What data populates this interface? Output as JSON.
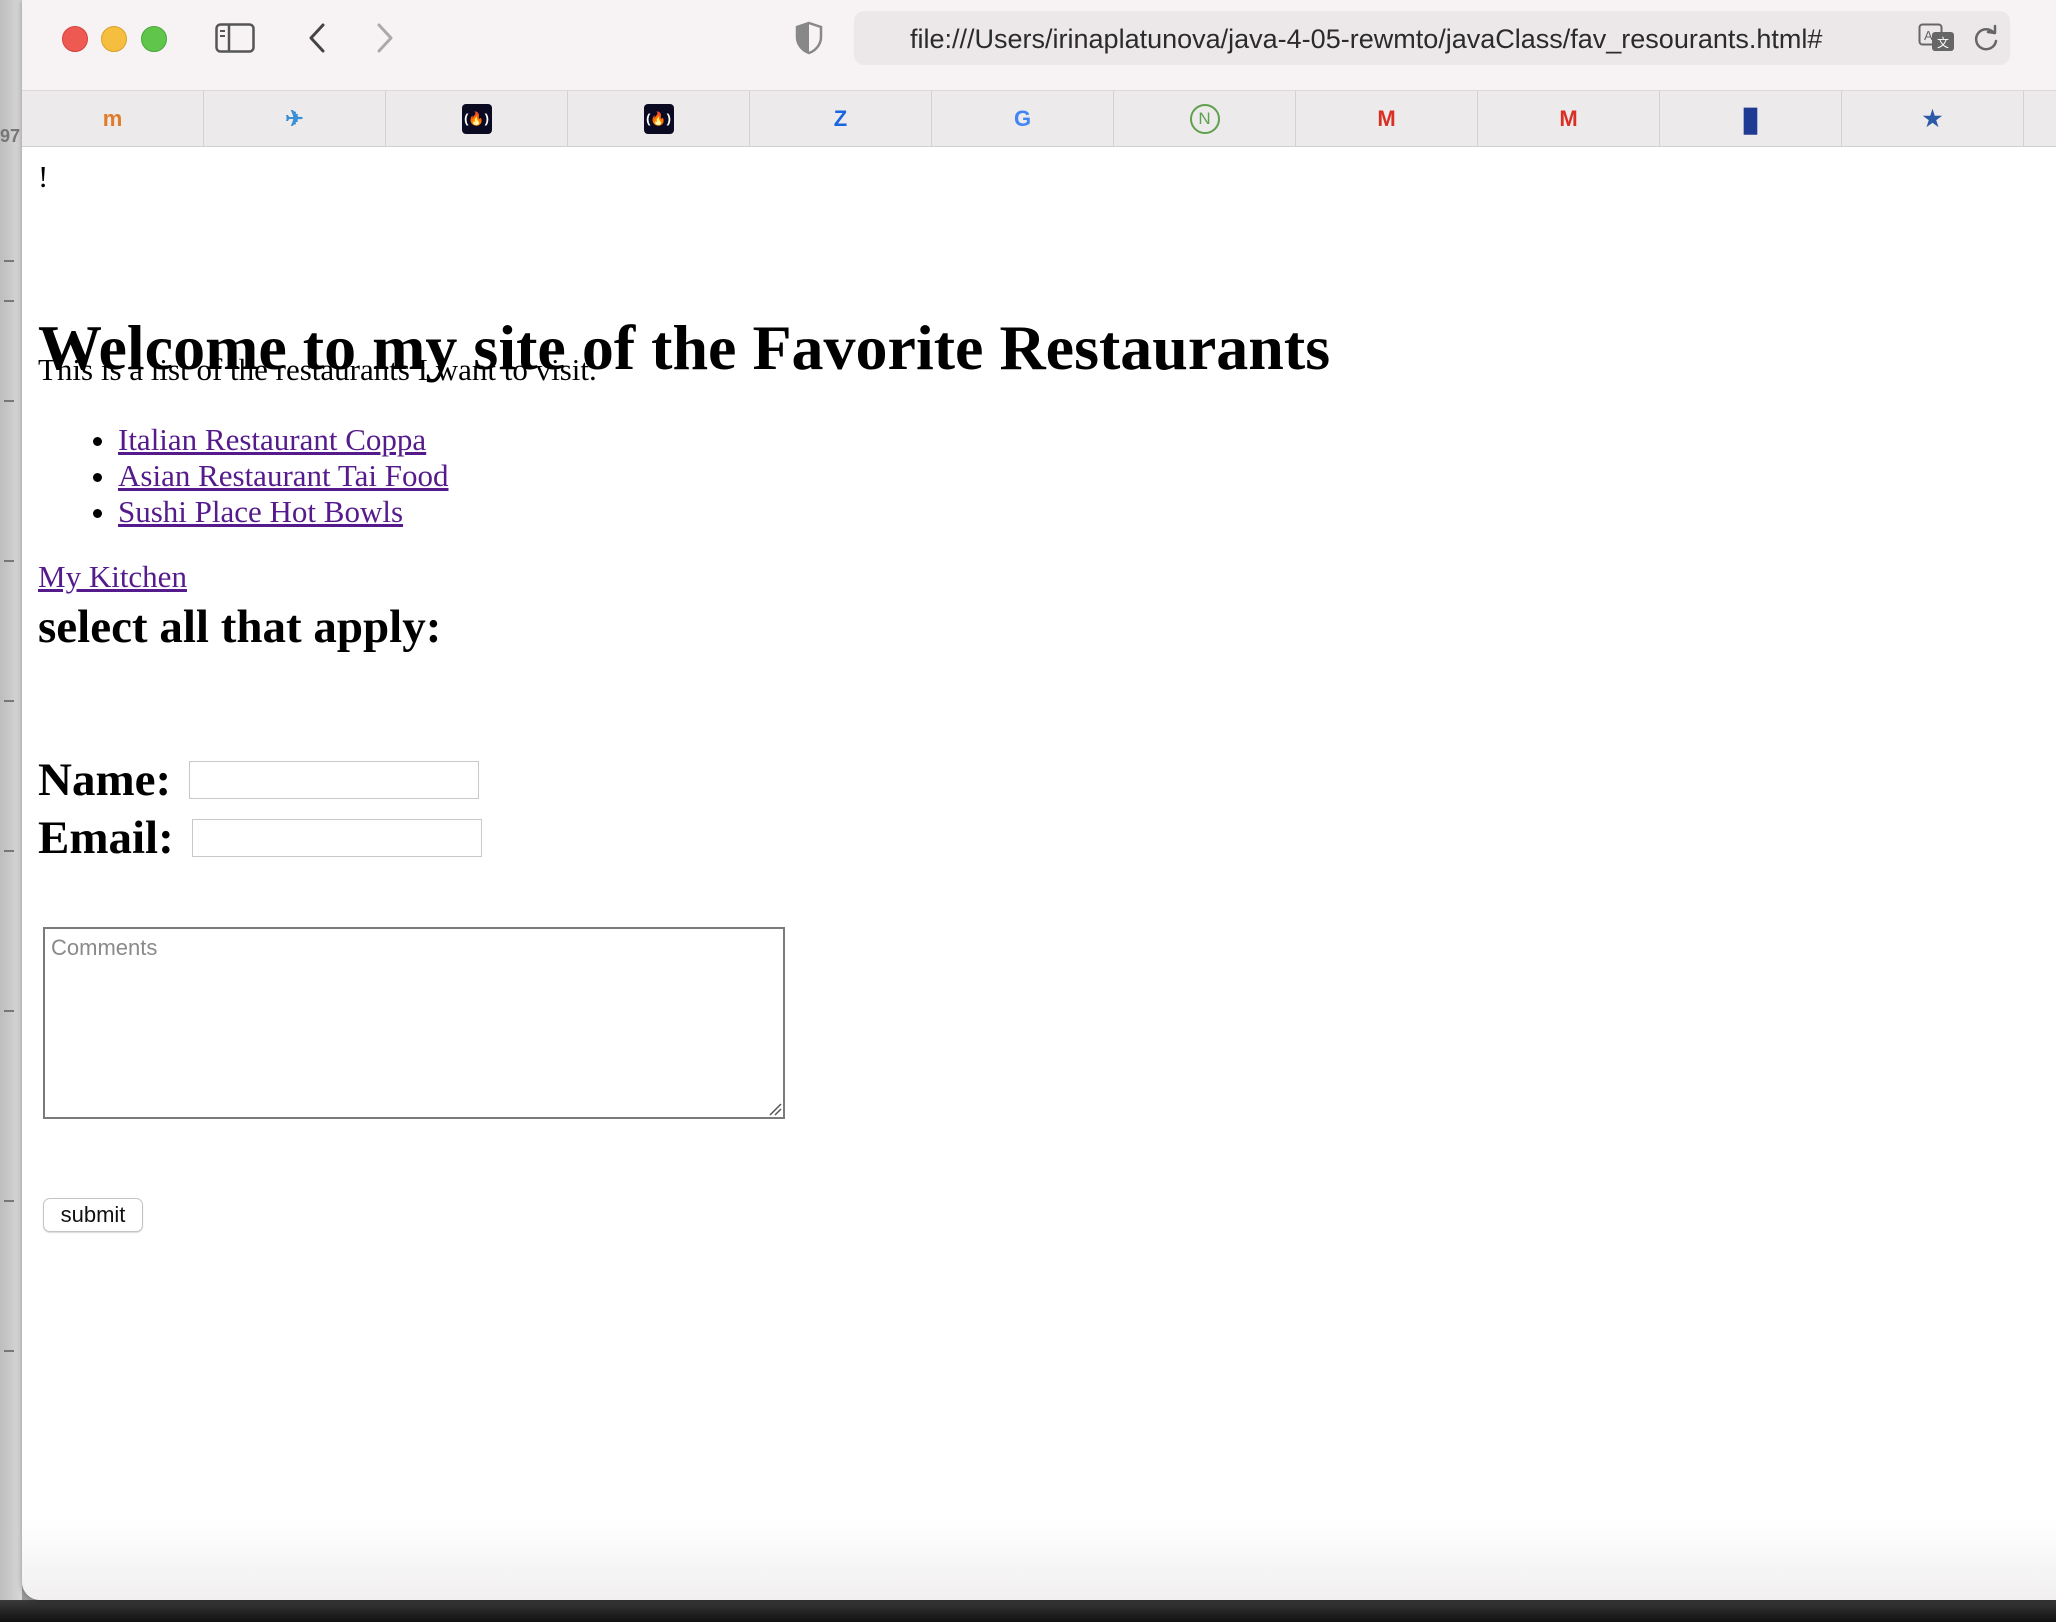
{
  "browser": {
    "url": "file:///Users/irinaplatunova/java-4-05-rewmto/javaClass/fav_resourants.html#",
    "favorites": [
      {
        "icon": "moodle-icon",
        "glyph": "m",
        "color": "#e07b2a"
      },
      {
        "icon": "bird-icon",
        "glyph": "✈",
        "color": "#3a8ed6"
      },
      {
        "icon": "freecodecamp-icon",
        "glyph": "(🔥)",
        "color": "#0a0a23"
      },
      {
        "icon": "freecodecamp-icon",
        "glyph": "(🔥)",
        "color": "#0a0a23"
      },
      {
        "icon": "zillow-icon",
        "glyph": "Z",
        "color": "#1a66e0"
      },
      {
        "icon": "google-icon",
        "glyph": "G",
        "color": "#4285f4"
      },
      {
        "icon": "nodejs-icon",
        "glyph": "N",
        "color": "#5fa04e"
      },
      {
        "icon": "gmail-icon",
        "glyph": "M",
        "color": "#d93025"
      },
      {
        "icon": "gmail-icon",
        "glyph": "M",
        "color": "#d93025"
      },
      {
        "icon": "book-icon",
        "glyph": "▮",
        "color": "#1f3a93"
      },
      {
        "icon": "star-icon",
        "glyph": "★",
        "color": "#2a5aa8"
      }
    ]
  },
  "page": {
    "bang": "!",
    "heading": "Welcome to my site of the Favorite Restaurants",
    "intro": "This is a list of the restaurants I want to visit.",
    "restaurants": [
      "Italian Restaurant Coppa",
      "Asian Restaurant Tai Food",
      "Sushi Place Hot Bowls"
    ],
    "kitchen_link": "My Kitchen",
    "select_heading": "select all that apply:",
    "name_label": "Name:",
    "email_label": "Email:",
    "name_value": "",
    "email_value": "",
    "comments_placeholder": "Comments",
    "submit_label": "submit"
  },
  "colors": {
    "link": "#551a8b",
    "close": "#ee5a52",
    "minimize": "#f5be3e",
    "zoom": "#5fc64b"
  }
}
